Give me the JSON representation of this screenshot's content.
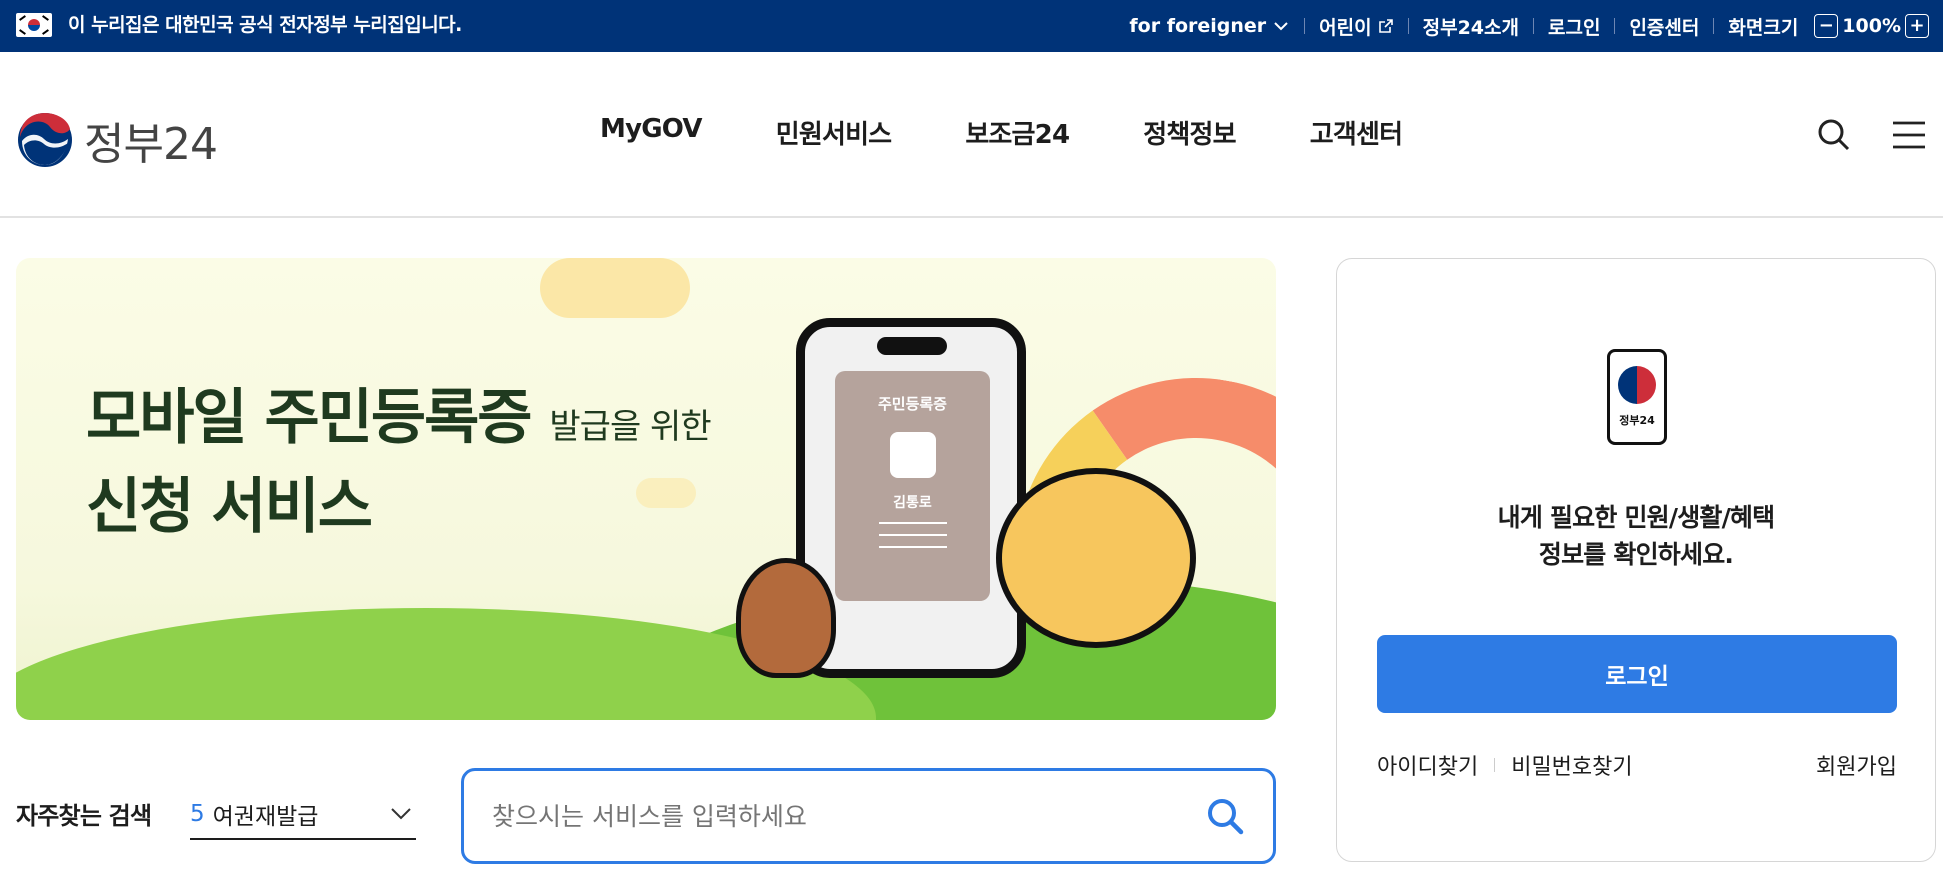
{
  "topbar": {
    "notice": "이 누리집은 대한민국 공식 전자정부 누리집입니다.",
    "foreigner": "for foreigner",
    "kids": "어린이",
    "about": "정부24소개",
    "login": "로그인",
    "cert": "인증센터",
    "screen_size": "화면크기",
    "zoom_minus": "−",
    "zoom_level": "100%",
    "zoom_plus": "+"
  },
  "header": {
    "logo_text": "정부24",
    "menu": [
      "MyGOV",
      "민원서비스",
      "보조금24",
      "정책정보",
      "고객센터"
    ]
  },
  "banner": {
    "title_line1": "모바일 주민등록증",
    "title_line1_small": "발급을 위한",
    "title_line2": "신청 서비스",
    "card_title": "주민등록증",
    "card_name": "김통로"
  },
  "login_panel": {
    "device_label": "정부24",
    "message_line1": "내게 필요한 민원/생활/혜택",
    "message_line2": "정보를 확인하세요.",
    "login_button": "로그인",
    "find_id": "아이디찾기",
    "find_password": "비밀번호찾기",
    "join": "회원가입"
  },
  "frequent_search": {
    "label": "자주찾는 검색",
    "rank": "5",
    "value": "여권재발급"
  },
  "search": {
    "placeholder": "찾으시는 서비스를 입력하세요"
  },
  "colors": {
    "topbar_bg": "#003378",
    "accent": "#2e7be4"
  }
}
